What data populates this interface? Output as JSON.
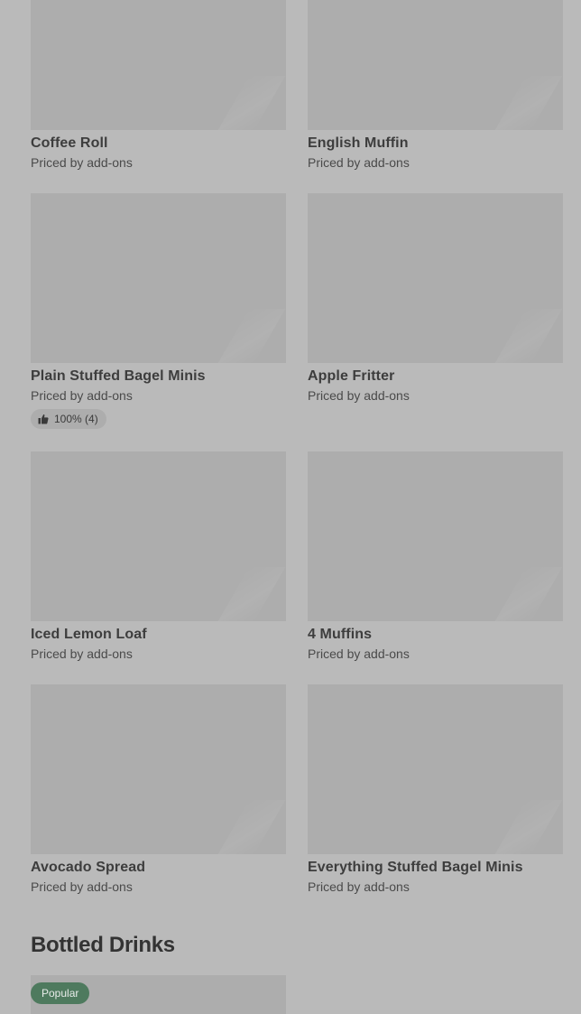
{
  "items": [
    {
      "name": "Coffee Roll",
      "price": "Priced by add-ons"
    },
    {
      "name": "English Muffin",
      "price": "Priced by add-ons"
    },
    {
      "name": "Plain Stuffed Bagel Minis",
      "price": "Priced by add-ons",
      "rating": "100% (4)"
    },
    {
      "name": "Apple Fritter",
      "price": "Priced by add-ons"
    },
    {
      "name": "Iced Lemon Loaf",
      "price": "Priced by add-ons"
    },
    {
      "name": "4 Muffins",
      "price": "Priced by add-ons"
    },
    {
      "name": "Avocado Spread",
      "price": "Priced by add-ons"
    },
    {
      "name": "Everything Stuffed Bagel Minis",
      "price": "Priced by add-ons"
    }
  ],
  "section": {
    "title": "Bottled Drinks"
  },
  "bottled_drinks": {
    "first_item_badge": "Popular"
  },
  "colors": {
    "background": "#bababa",
    "thumbnail": "#adadad",
    "badge": "#4e7a5e"
  }
}
